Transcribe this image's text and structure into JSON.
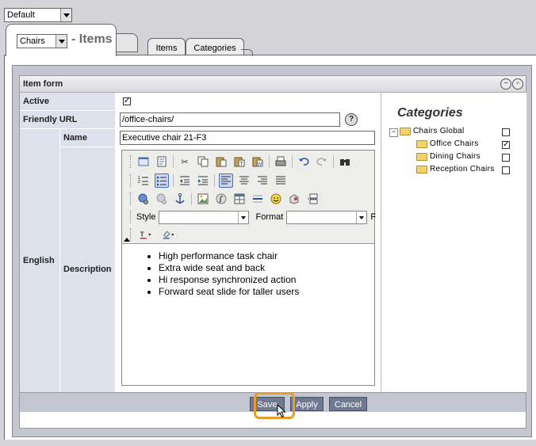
{
  "top_select": {
    "value": "Default"
  },
  "header": {
    "section_select": "Chairs",
    "title": "- Items",
    "tabs": [
      {
        "label": "Items"
      },
      {
        "label": "Categories"
      }
    ]
  },
  "form": {
    "title": "Item form",
    "header_buttons": [
      "minimize-icon",
      "restore-icon"
    ],
    "active": {
      "label": "Active",
      "checked": true,
      "mark": "✓"
    },
    "friendly_url": {
      "label": "Friendly URL",
      "value": "/office-chairs/",
      "help": "?"
    },
    "language": "English",
    "name": {
      "label": "Name",
      "value": "Executive chair 21-F3"
    },
    "description": {
      "label": "Description",
      "bullets": [
        "High performance task chair",
        "Extra wide seat and back",
        "Hi response synchronized action",
        "Forward seat slide for taller users"
      ]
    }
  },
  "editor": {
    "style_label": "Style",
    "format_label": "Format",
    "font_label": "F",
    "toolbar_icons": [
      [
        "source-icon",
        "preview-icon",
        "cut-icon",
        "copy-icon",
        "paste-icon",
        "paste-text-icon",
        "paste-word-icon",
        "print-icon",
        "undo-icon",
        "redo-icon",
        "find-icon"
      ],
      [
        "numbered-list-icon",
        "bulleted-list-icon",
        "outdent-icon",
        "indent-icon",
        "align-left-icon",
        "align-center-icon",
        "align-right-icon",
        "justify-icon"
      ],
      [
        "link-icon",
        "unlink-icon",
        "anchor-icon",
        "image-icon",
        "flash-icon",
        "table-icon",
        "rule-icon",
        "smiley-icon",
        "special-char-icon",
        "page-break-icon"
      ],
      [
        "text-color-icon",
        "background-color-icon"
      ]
    ]
  },
  "categories": {
    "title": "Categories",
    "root": {
      "label": "Chairs Global",
      "checked": false
    },
    "items": [
      {
        "label": "Office Chairs",
        "checked": true,
        "mark": "✓"
      },
      {
        "label": "Dining Chairs",
        "checked": false,
        "mark": ""
      },
      {
        "label": "Reception Chairs",
        "checked": false,
        "mark": ""
      }
    ]
  },
  "buttons": {
    "save": "Save",
    "apply": "Apply",
    "cancel": "Cancel"
  },
  "colors": {
    "highlight": "#e69b2b",
    "button": "#6f7a92",
    "label_bg": "#dde1ec"
  }
}
